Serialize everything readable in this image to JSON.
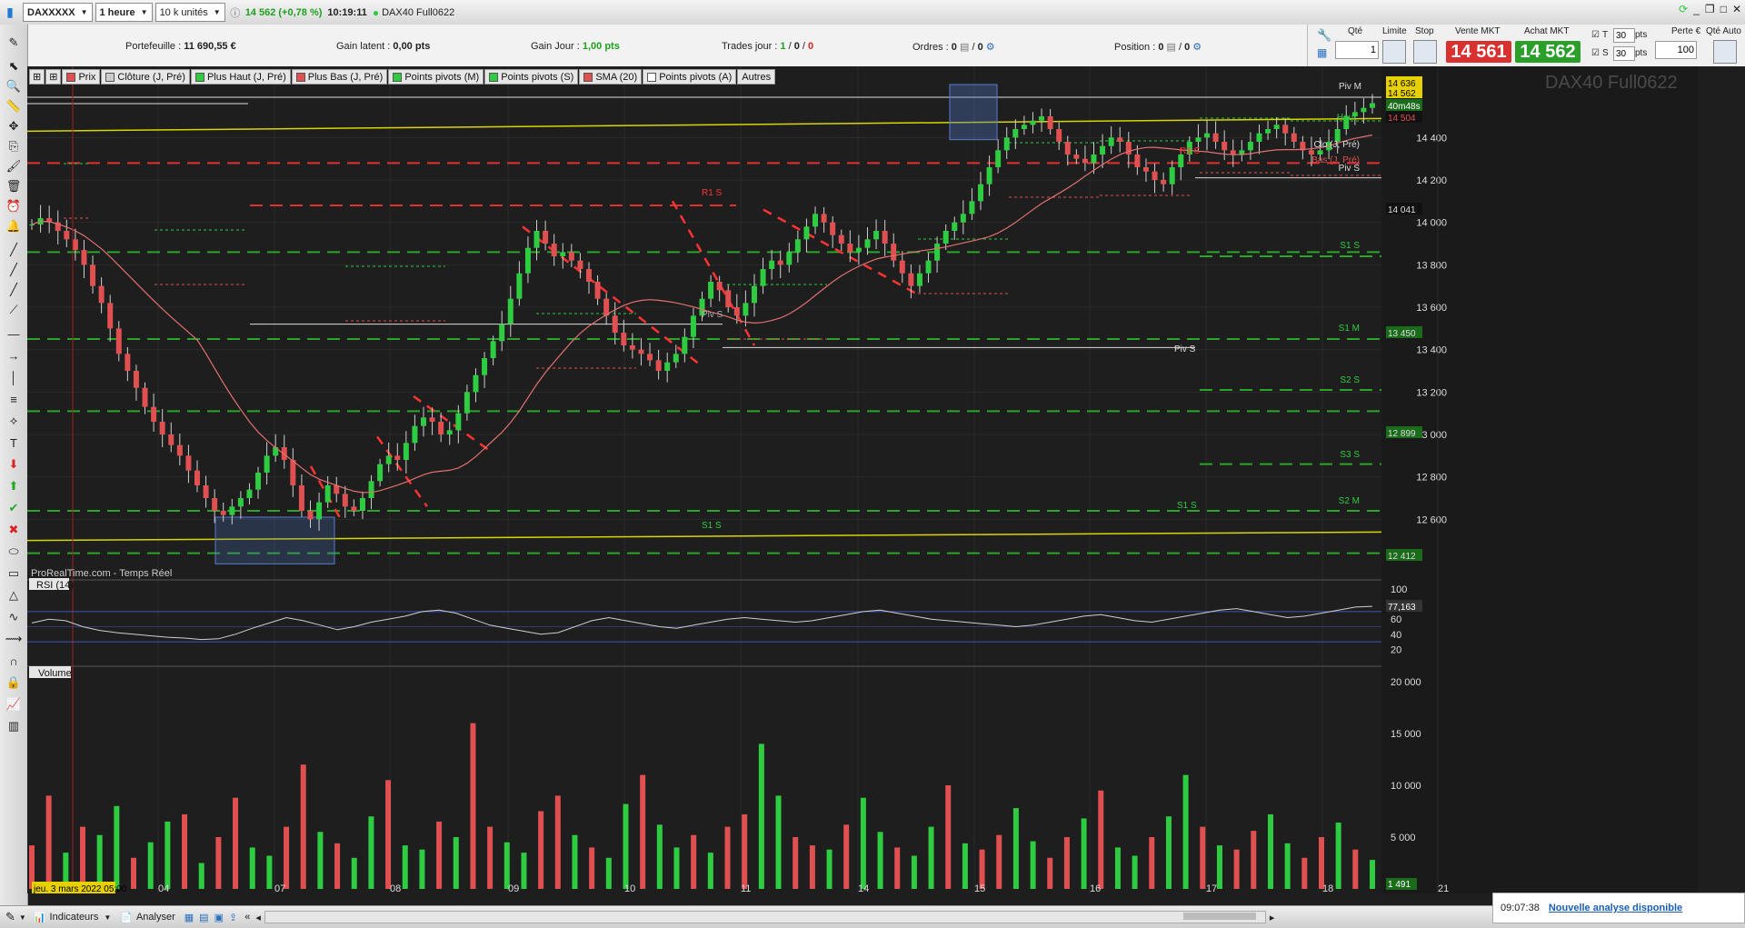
{
  "topbar": {
    "instrument": "DAXXXXX",
    "timeframe": "1 heure",
    "units": "10 k unités",
    "price_change": "14 562 (+0,78 %)",
    "time": "10:19:11",
    "contract": "DAX40 Full0622"
  },
  "info": {
    "portfolio_label": "Portefeuille :",
    "portfolio_value": "11 690,55 €",
    "latent_label": "Gain latent :",
    "latent_value": "0,00 pts",
    "day_label": "Gain Jour :",
    "day_value": "1,00 pts",
    "trades_label": "Trades jour :",
    "trades_value_1": "1",
    "trades_value_2": "0",
    "trades_value_3": "0",
    "orders_label": "Ordres :",
    "orders_value_1": "0",
    "orders_value_2": "0",
    "position_label": "Position :",
    "position_value_1": "0",
    "position_value_2": "0"
  },
  "order_panel": {
    "qty_label": "Qté",
    "qty_value": "1",
    "limit_label": "Limite",
    "stop_label": "Stop",
    "sell_label": "Vente MKT",
    "sell_price": "14 561",
    "buy_label": "Achat MKT",
    "buy_price": "14 562",
    "t_label": "T",
    "t_value": "30",
    "s_label": "S",
    "s_value": "30",
    "pts": "pts",
    "loss_label": "Perte €",
    "loss_value": "100",
    "auto_qty_label": "Qté Auto"
  },
  "legend": [
    {
      "label": "Prix",
      "color": "#e05050"
    },
    {
      "label": "Clôture (J, Pré)",
      "color": "#cccccc"
    },
    {
      "label": "Plus Haut (J, Pré)",
      "color": "#2ecc40"
    },
    {
      "label": "Plus Bas (J, Pré)",
      "color": "#e05050"
    },
    {
      "label": "Points pivots (M)",
      "color": "#2ecc40"
    },
    {
      "label": "Points pivots (S)",
      "color": "#2ecc40"
    },
    {
      "label": "SMA (20)",
      "color": "#e05050"
    },
    {
      "label": "Points pivots (A)",
      "color": "#ffffff"
    },
    {
      "label": "Autres",
      "color": ""
    }
  ],
  "watermark": "DAX40 Full0622",
  "source": "ProRealTime.com - Temps Réel",
  "rsi_label": "RSI (14)",
  "rsi_value": "77,163",
  "volume_label": "Volume",
  "volume_value": "1 491",
  "price_tags": {
    "t1": "14 636",
    "t2": "14 562",
    "t3": "40m48s",
    "t4": "14 504",
    "t5": "14 041",
    "t6": "13 450",
    "t7": "12 899",
    "t8": "12 412"
  },
  "level_labels": {
    "pivM": "Piv M",
    "clo": "Clo (J, Pré)",
    "bas": "Bas (J, Pré)",
    "pivS": "Piv S",
    "r1s_left": "R1 S",
    "r1s_right": "R1 S",
    "s1s": "S1 S",
    "s1m": "S1 M",
    "s2s": "S2 S",
    "s3s": "S3 S",
    "s2m": "S2 M",
    "s1s_left": "S1 S",
    "s1s_right": "S1 S",
    "pivS_mid": "Piv S",
    "pivS_left": "Piv S",
    "haut": "Haut"
  },
  "chart_data": {
    "type": "candlestick",
    "title": "DAX40 Full0622",
    "y_ticks": [
      "14 400",
      "14 200",
      "14 000",
      "13 800",
      "13 600",
      "13 400",
      "13 200",
      "13 000",
      "12 800",
      "12 600"
    ],
    "ylim": [
      12400,
      14650
    ],
    "x_ticks": [
      "jeu. 3 mars 2022 05:00",
      "04",
      "07",
      "08",
      "09",
      "10",
      "11",
      "14",
      "15",
      "16",
      "17",
      "18",
      "21"
    ],
    "closes": [
      13990,
      14020,
      14000,
      13960,
      13920,
      13870,
      13800,
      13700,
      13620,
      13500,
      13380,
      13300,
      13220,
      13130,
      13060,
      13000,
      12950,
      12900,
      12830,
      12760,
      12700,
      12640,
      12620,
      12660,
      12700,
      12740,
      12820,
      12900,
      12940,
      12880,
      12760,
      12640,
      12600,
      12680,
      12760,
      12720,
      12660,
      12640,
      12700,
      12780,
      12860,
      12900,
      12880,
      12960,
      13040,
      13080,
      13060,
      13000,
      13020,
      13100,
      13200,
      13280,
      13360,
      13440,
      13520,
      13640,
      13760,
      13880,
      13960,
      13900,
      13840,
      13860,
      13820,
      13780,
      13720,
      13640,
      13560,
      13480,
      13420,
      13400,
      13380,
      13350,
      13300,
      13340,
      13380,
      13460,
      13560,
      13640,
      13720,
      13680,
      13600,
      13560,
      13620,
      13700,
      13780,
      13820,
      13800,
      13860,
      13920,
      13980,
      14040,
      14000,
      13940,
      13900,
      13860,
      13880,
      13920,
      13960,
      13900,
      13820,
      13760,
      13700,
      13760,
      13820,
      13900,
      13960,
      14000,
      14040,
      14100,
      14180,
      14260,
      14340,
      14400,
      14440,
      14460,
      14480,
      14500,
      14440,
      14380,
      14320,
      14300,
      14280,
      14320,
      14360,
      14400,
      14380,
      14320,
      14260,
      14240,
      14200,
      14180,
      14260,
      14320,
      14380,
      14400,
      14420,
      14380,
      14340,
      14320,
      14340,
      14380,
      14420,
      14440,
      14460,
      14420,
      14380,
      14340,
      14320,
      14340,
      14380,
      14440,
      14500,
      14520,
      14540,
      14562
    ],
    "sma_note": "",
    "rsi": {
      "ylim": [
        0,
        100
      ],
      "y_ticks": [
        "100",
        "80",
        "60",
        "40",
        "20"
      ],
      "values": [
        55,
        60,
        58,
        50,
        45,
        42,
        40,
        38,
        36,
        35,
        33,
        34,
        40,
        48,
        55,
        62,
        58,
        52,
        46,
        50,
        56,
        60,
        64,
        70,
        72,
        68,
        60,
        52,
        48,
        44,
        40,
        42,
        50,
        58,
        62,
        58,
        54,
        50,
        48,
        52,
        56,
        60,
        62,
        60,
        58,
        56,
        58,
        62,
        66,
        70,
        72,
        68,
        64,
        60,
        58,
        56,
        54,
        52,
        50,
        52,
        56,
        60,
        64,
        66,
        62,
        58,
        56,
        60,
        64,
        68,
        72,
        74,
        70,
        66,
        62,
        64,
        68,
        72,
        76,
        77
      ]
    },
    "volume": {
      "y_ticks": [
        "20 000",
        "15 000",
        "10 000",
        "5 000"
      ],
      "values": [
        4200,
        9000,
        3500,
        6000,
        5200,
        8000,
        3000,
        4500,
        6500,
        7200,
        2500,
        5000,
        8800,
        4000,
        3200,
        6000,
        12000,
        5500,
        4400,
        3000,
        7000,
        10500,
        4200,
        3800,
        6500,
        5000,
        16000,
        6000,
        4500,
        3500,
        7500,
        9000,
        5200,
        4000,
        3000,
        8200,
        11000,
        6200,
        4000,
        5200,
        3500,
        6000,
        7200,
        14000,
        9000,
        5000,
        4200,
        3800,
        6200,
        8800,
        5500,
        4000,
        3200,
        6000,
        10000,
        4400,
        3800,
        5200,
        7800,
        4600,
        3000,
        5000,
        6800,
        9500,
        4000,
        3200,
        5000,
        7000,
        11000,
        6000,
        4200,
        3800,
        5600,
        7200,
        4400,
        3000,
        5000,
        6400,
        3800,
        2800
      ]
    }
  }
}
